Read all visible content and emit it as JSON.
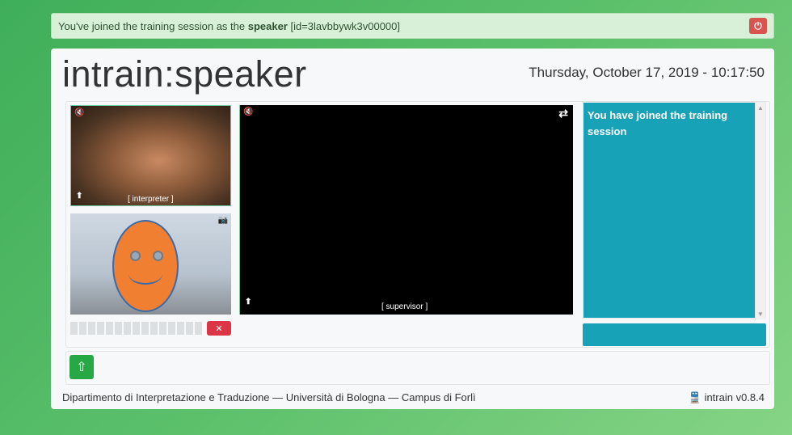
{
  "alert": {
    "prefix": "You've joined the training session as the ",
    "role": "speaker",
    "suffix": " [id=3lavbbywk3v00000]",
    "power_icon": "power-icon"
  },
  "header": {
    "title": "intrain:speaker",
    "datetime": "Thursday, October 17, 2019 - 10:17:50"
  },
  "videos": {
    "interpreter_label": "[ interpreter ]",
    "supervisor_label": "[ supervisor ]"
  },
  "chat": {
    "message": "You have joined the training session",
    "input_placeholder": ""
  },
  "footer": {
    "department": "Dipartimento di Interpretazione e Traduzione — Università di Bologna — Campus di Forlì",
    "version": "intrain v0.8.4"
  },
  "colors": {
    "chat_bg": "#17a2b8",
    "power_btn": "#d9534f",
    "mute_btn": "#dc3545",
    "upload_btn": "#28a745"
  }
}
